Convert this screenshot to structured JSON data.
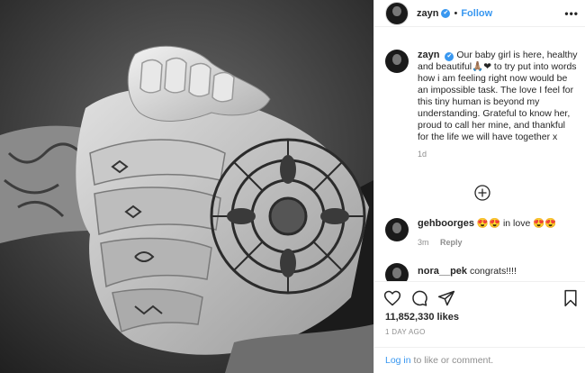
{
  "post": {
    "username": "zayn",
    "verified_badge": "✔",
    "follow_label": "Follow",
    "separator": "•",
    "more_icon": "•••",
    "photo_alt": "black-and-white photo of a baby's hand holding a tattooed hand"
  },
  "caption": {
    "username": "zayn",
    "text": "Our baby girl is here, healthy and beautiful🙏🏽❤ to try put into words how i am feeling right now would be an impossible task. The love I feel for this tiny human is beyond my understanding. Grateful to know her, proud to call her mine, and thankful for the life we will have together x",
    "time": "1d"
  },
  "comments": [
    {
      "username": "gehboorges",
      "text": "😍😍 in love 😍😍",
      "time": "3m",
      "reply_label": "Reply"
    },
    {
      "username": "nora__pek",
      "text": "congrats!!!!"
    }
  ],
  "footer": {
    "likes": "11,852,330 likes",
    "date": "1 DAY AGO",
    "login_link": "Log in",
    "login_rest": " to like or comment."
  },
  "colors": {
    "accent": "#3897f0",
    "text": "#262626",
    "muted": "#8e8e8e",
    "border": "#efefef"
  }
}
